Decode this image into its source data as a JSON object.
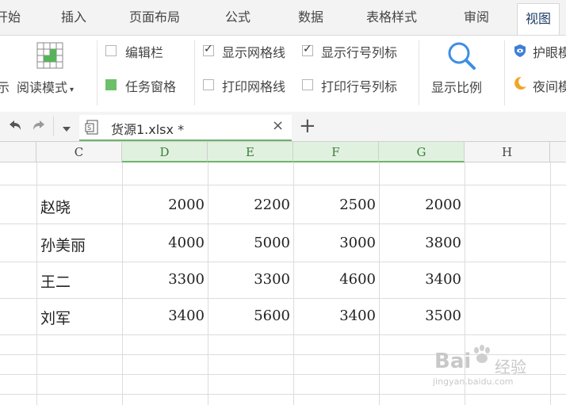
{
  "menu_tabs": [
    "开始",
    "插入",
    "页面布局",
    "公式",
    "数据",
    "表格样式",
    "审阅",
    "视图"
  ],
  "ribbon": {
    "reading_mode": "阅读模式",
    "full_screen_partial": "示",
    "edit_bar": "编辑栏",
    "task_pane": "任务窗格",
    "show_gridlines": "显示网格线",
    "print_gridlines": "打印网格线",
    "show_row_col": "显示行号列标",
    "print_row_col": "打印行号列标",
    "zoom": "显示比例",
    "eye_protect": "护眼模",
    "night_mode": "夜间模"
  },
  "file": {
    "name": "货源1.xlsx *"
  },
  "columns": [
    "C",
    "D",
    "E",
    "F",
    "G",
    "H"
  ],
  "rows": [
    {
      "name": "赵晓",
      "d": "2000",
      "e": "2200",
      "f": "2500",
      "g": "2000"
    },
    {
      "name": "孙美丽",
      "d": "4000",
      "e": "5000",
      "f": "3000",
      "g": "3800"
    },
    {
      "name": "王二",
      "d": "3300",
      "e": "3300",
      "f": "4600",
      "g": "3400"
    },
    {
      "name": "刘军",
      "d": "3400",
      "e": "5600",
      "f": "3400",
      "g": "3500"
    }
  ],
  "watermark": {
    "brand": "Bai",
    "brand_cn": "经验",
    "url": "jingyan.baidu.com"
  }
}
